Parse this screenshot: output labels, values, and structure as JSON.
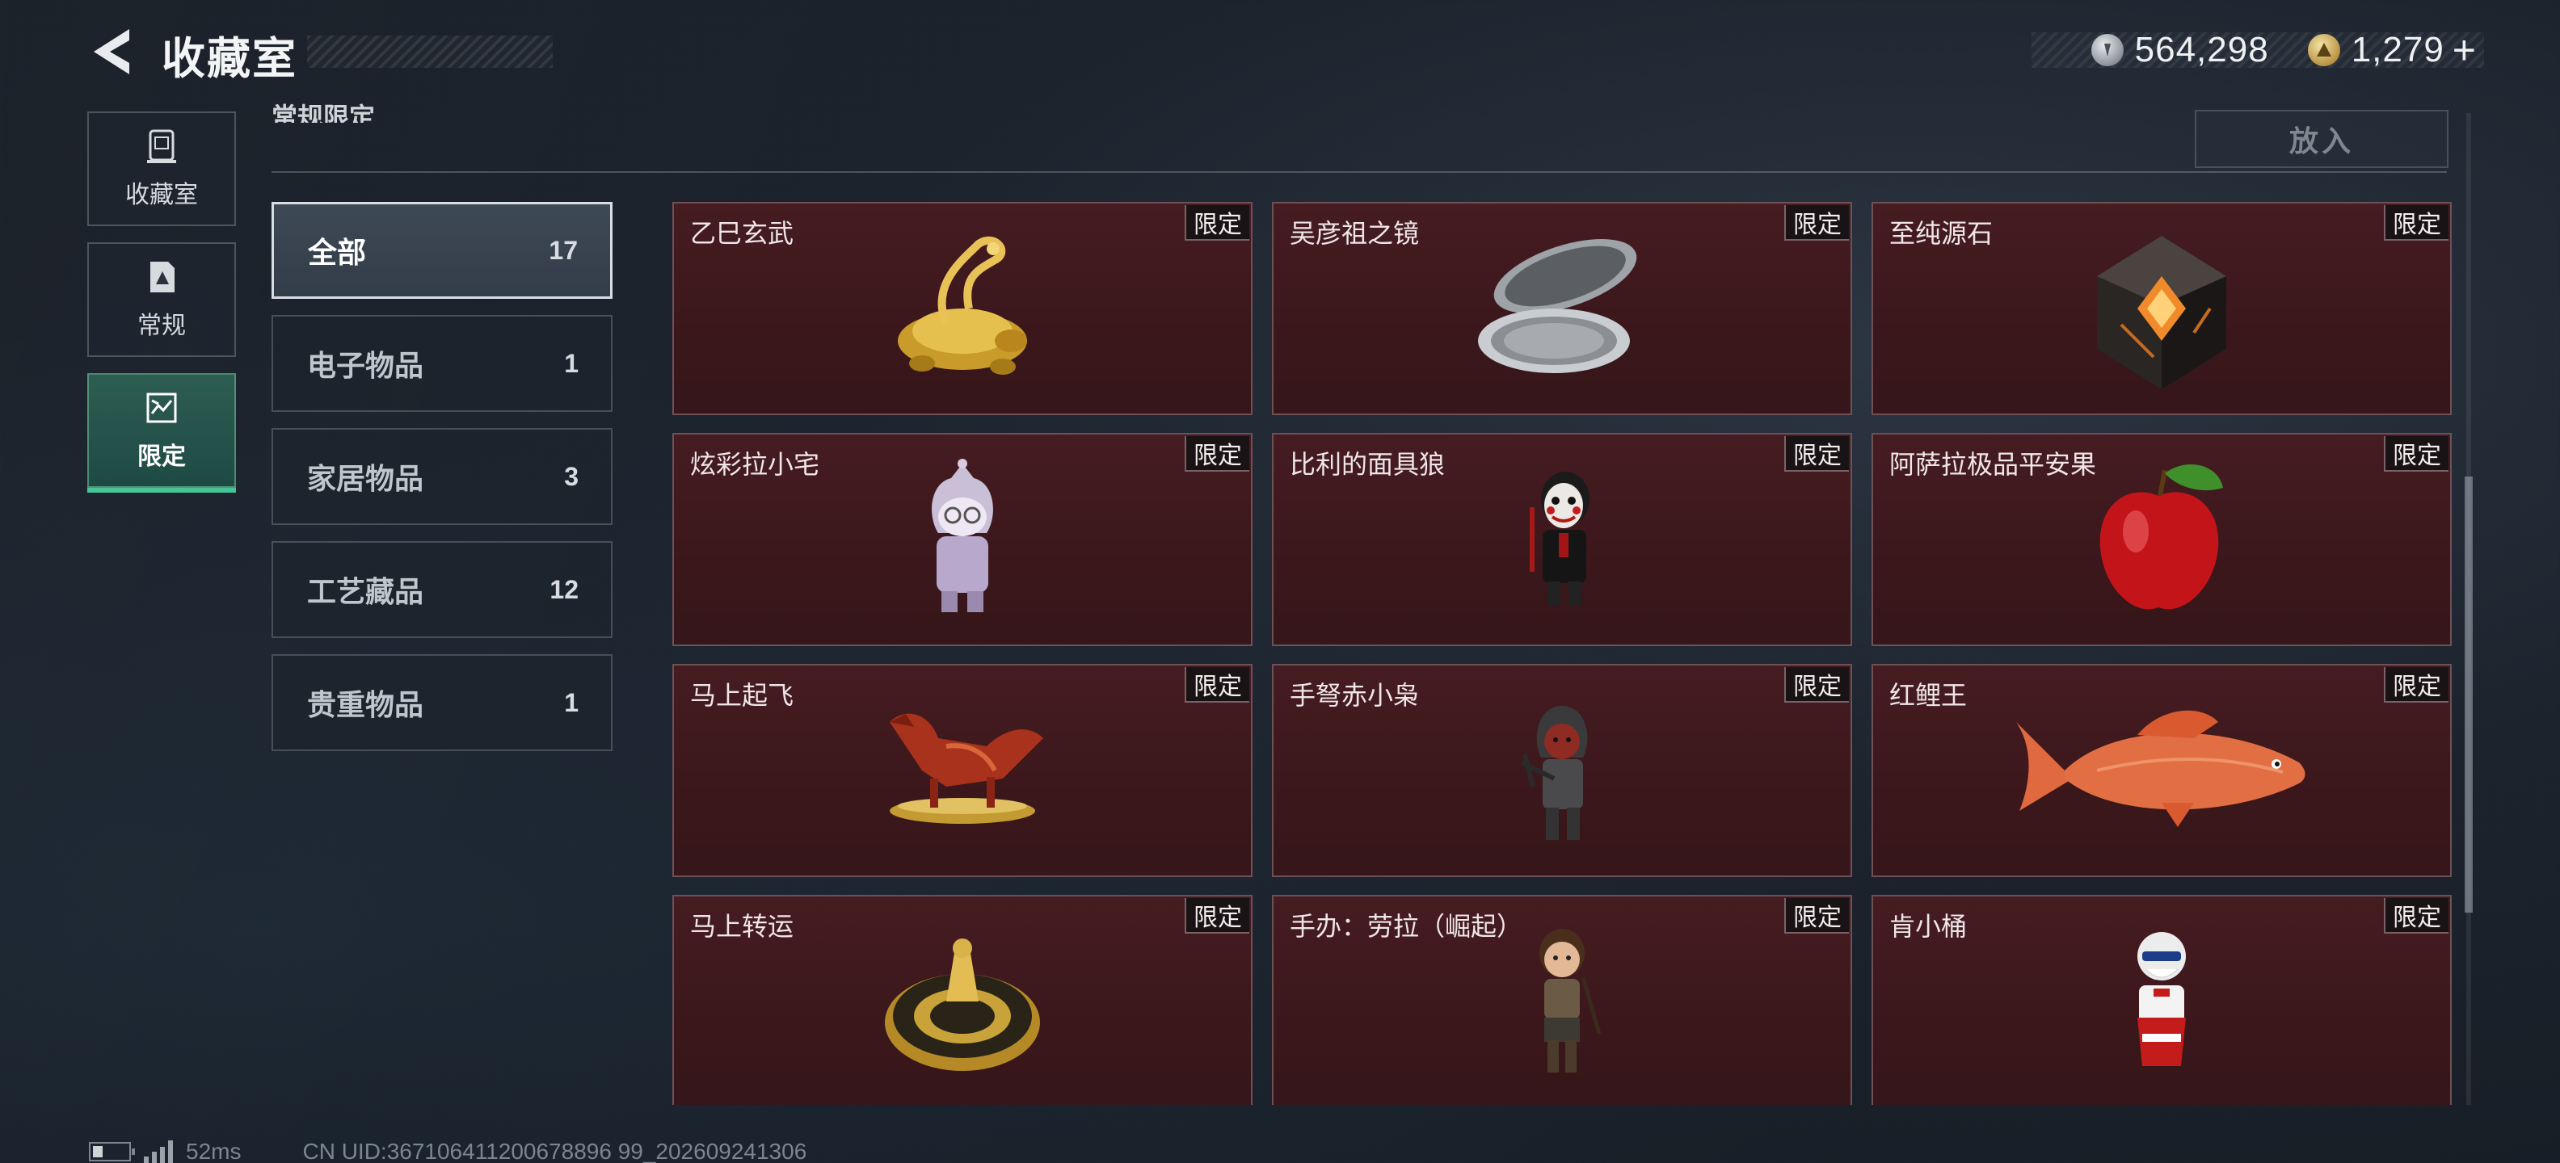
{
  "header": {
    "title": "收藏室",
    "back_icon": "back-arrow-icon",
    "currencies": [
      {
        "icon": "silver-coin-icon",
        "value": "564,298"
      },
      {
        "icon": "gold-coin-icon",
        "value": "1,279",
        "plus": "+"
      }
    ]
  },
  "nav": [
    {
      "label": "收藏室",
      "icon": "collection-room-icon",
      "active": false
    },
    {
      "label": "常规",
      "icon": "regular-icon",
      "active": false
    },
    {
      "label": "限定",
      "icon": "limited-icon",
      "active": true
    }
  ],
  "section": {
    "heading": "常规限定",
    "put_button": "放入"
  },
  "categories": [
    {
      "name": "全部",
      "count": "17",
      "active": true
    },
    {
      "name": "电子物品",
      "count": "1",
      "active": false
    },
    {
      "name": "家居物品",
      "count": "3",
      "active": false
    },
    {
      "name": "工艺藏品",
      "count": "12",
      "active": false
    },
    {
      "name": "贵重物品",
      "count": "1",
      "active": false
    }
  ],
  "items": [
    {
      "name": "乙巳玄武",
      "tag": "限定",
      "icon": "golden-snake-turtle-icon"
    },
    {
      "name": "吴彦祖之镜",
      "tag": "限定",
      "icon": "compact-mirror-icon"
    },
    {
      "name": "至纯源石",
      "tag": "限定",
      "icon": "originium-stone-icon"
    },
    {
      "name": "炫彩拉小宅",
      "tag": "限定",
      "icon": "hooded-figure-icon"
    },
    {
      "name": "比利的面具狼",
      "tag": "限定",
      "icon": "billy-puppet-icon"
    },
    {
      "name": "阿萨拉极品平安果",
      "tag": "限定",
      "icon": "red-apple-icon"
    },
    {
      "name": "马上起飞",
      "tag": "限定",
      "icon": "red-horse-icon"
    },
    {
      "name": "手弩赤小枭",
      "tag": "限定",
      "icon": "crossbow-figure-icon"
    },
    {
      "name": "红鲤王",
      "tag": "限定",
      "icon": "red-carp-icon"
    },
    {
      "name": "马上转运",
      "tag": "限定",
      "icon": "golden-wheel-icon"
    },
    {
      "name": "手办：劳拉（崛起）",
      "tag": "限定",
      "icon": "lara-figure-icon"
    },
    {
      "name": "肯小桶",
      "tag": "限定",
      "icon": "colonel-figure-icon"
    }
  ],
  "status": {
    "ping": "52ms",
    "uid": "CN UID:367106411200678896 99_202609241306"
  }
}
